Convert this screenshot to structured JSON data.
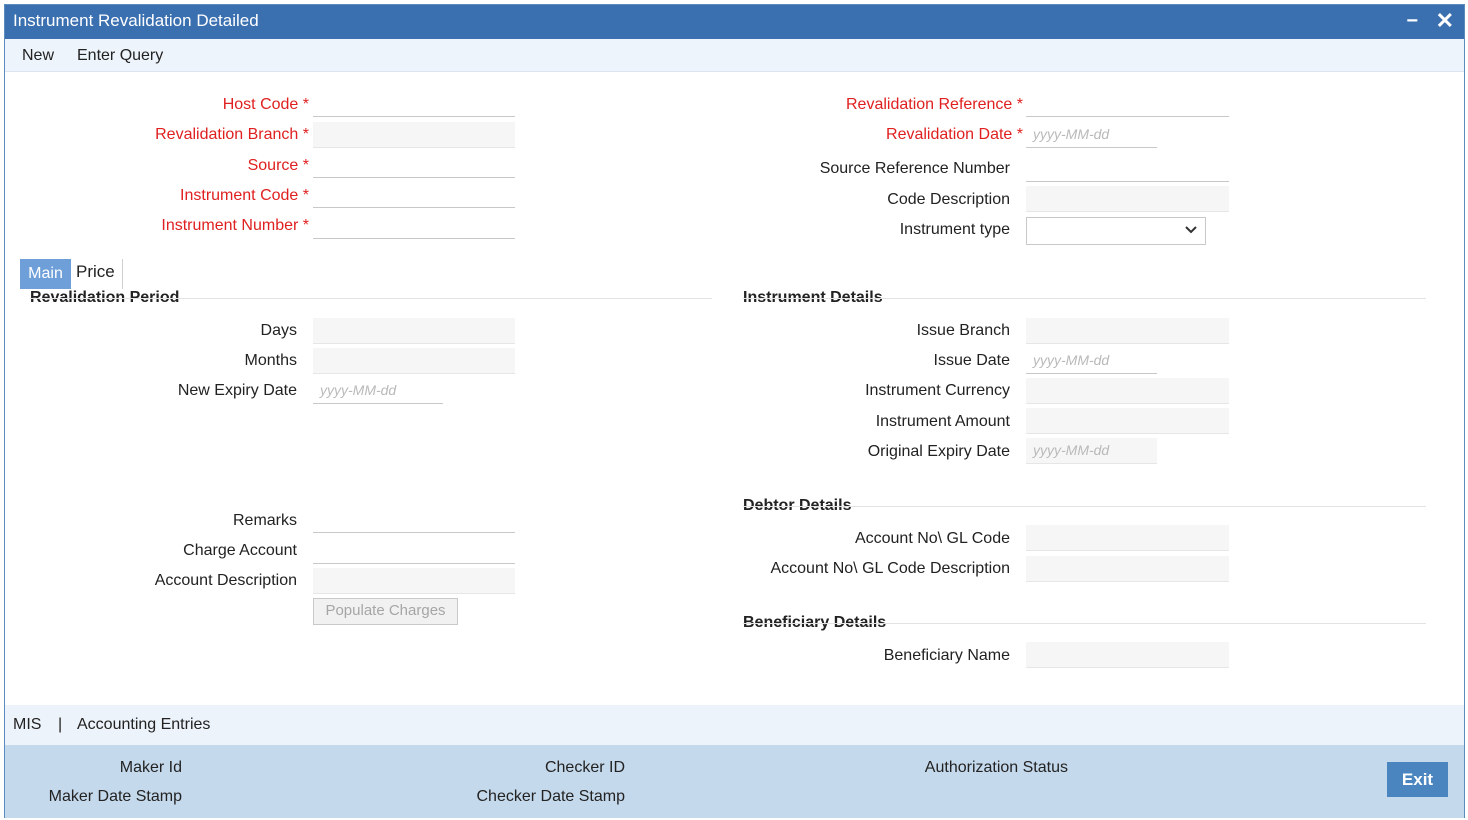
{
  "window": {
    "title": "Instrument Revalidation Detailed",
    "minimize_glyph": "−",
    "close_glyph": "✕"
  },
  "menu": {
    "new": "New",
    "enter_query": "Enter Query"
  },
  "header_left": {
    "host_code": "Host Code",
    "revalidation_branch": "Revalidation Branch",
    "source": "Source",
    "instrument_code": "Instrument Code",
    "instrument_number": "Instrument Number"
  },
  "header_right": {
    "revalidation_reference": "Revalidation Reference",
    "revalidation_date": "Revalidation Date",
    "source_reference_number": "Source Reference Number",
    "code_description": "Code Description",
    "instrument_type": "Instrument type"
  },
  "required_marker": "*",
  "date_placeholder": "yyyy-MM-dd",
  "tabs": {
    "main": "Main",
    "price": "Price"
  },
  "revalidation_period": {
    "title": "Revalidation Period",
    "days": "Days",
    "months": "Months",
    "new_expiry_date": "New Expiry Date",
    "remarks": "Remarks",
    "charge_account": "Charge Account",
    "account_description": "Account Description",
    "populate_charges": "Populate Charges"
  },
  "instrument_details": {
    "title": "Instrument Details",
    "issue_branch": "Issue Branch",
    "issue_date": "Issue Date",
    "instrument_currency": "Instrument Currency",
    "instrument_amount": "Instrument Amount",
    "original_expiry_date": "Original Expiry Date"
  },
  "debtor_details": {
    "title": "Debtor Details",
    "account_gl_code": "Account No\\ GL Code",
    "account_gl_desc": "Account No\\ GL Code Description"
  },
  "beneficiary_details": {
    "title": "Beneficiary Details",
    "beneficiary_name": "Beneficiary Name"
  },
  "footer_links": {
    "mis": "MIS",
    "separator": "|",
    "accounting_entries": "Accounting Entries"
  },
  "audit": {
    "maker_id": "Maker Id",
    "maker_date_stamp": "Maker Date Stamp",
    "checker_id": "Checker ID",
    "checker_date_stamp": "Checker Date Stamp",
    "authorization_status": "Authorization Status",
    "exit": "Exit"
  },
  "icons": {
    "dropdown": "chevron-down-icon",
    "minimize": "minimize-icon",
    "close": "close-icon"
  },
  "colors": {
    "title_bar": "#3a6fb0",
    "required": "#e02020",
    "tab_active": "#6f9fd8",
    "audit_bar": "#c5d9ec",
    "exit_button": "#4a85bf"
  }
}
